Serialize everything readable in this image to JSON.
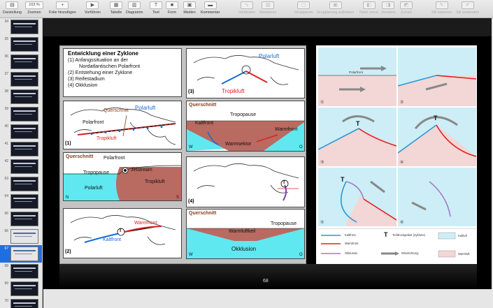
{
  "toolbar": {
    "items": [
      {
        "label": "Darstellung",
        "icon": "view-icon"
      },
      {
        "label": "Zoomen",
        "icon": "zoom-icon",
        "value": "103 %"
      },
      {
        "label": "Folie hinzufügen",
        "icon": "add-slide-icon"
      },
      {
        "label": "Vorführen",
        "icon": "play-icon"
      },
      {
        "label": "Tabelle",
        "icon": "table-icon"
      },
      {
        "label": "Diagramm",
        "icon": "chart-icon"
      },
      {
        "label": "Text",
        "icon": "text-icon"
      },
      {
        "label": "Form",
        "icon": "shape-icon"
      },
      {
        "label": "Medien",
        "icon": "media-icon"
      },
      {
        "label": "Kommentar",
        "icon": "comment-icon"
      },
      {
        "label": "Verbinden",
        "icon": "connect-icon"
      },
      {
        "label": "Maskieren",
        "icon": "mask-icon"
      },
      {
        "label": "Gruppieren",
        "icon": "group-icon"
      },
      {
        "label": "Gruppierung aufheben",
        "icon": "ungroup-icon"
      },
      {
        "label": "Nach vorne",
        "icon": "bring-forward-icon"
      },
      {
        "label": "Vorwärts",
        "icon": "forward-icon"
      },
      {
        "label": "Zurück",
        "icon": "backward-icon"
      },
      {
        "label": "Stil kopieren",
        "icon": "copy-style-icon"
      },
      {
        "label": "Stil anwenden",
        "icon": "paste-style-icon"
      }
    ]
  },
  "slides": [
    "34",
    "35",
    "36",
    "37",
    "38",
    "39",
    "40",
    "41",
    "42",
    "63",
    "64",
    "65",
    "66",
    "67",
    "68",
    "69",
    "70"
  ],
  "slide": {
    "title": "Entwicklung einer Zyklone",
    "list": [
      "(1)  Anfangssituation an der",
      "Nordatlantischen Polarfront",
      "(2)  Entstehung einer Zyklone",
      "(3)  Reifestadium",
      "(4)  Okklusion"
    ],
    "labels": {
      "querschnitt": "Querschnitt",
      "polarluft": "Polarluft",
      "polarfront": "Polarfront",
      "tropikluft": "Tropikluft",
      "tropopause": "Tropopause",
      "jetstream": "Jetstream",
      "warmfront": "Warmfront",
      "kaltfront": "Kaltfront",
      "warmsektor": "Warmsektor",
      "warmluftkeil": "Warmluftkeil",
      "okklusion": "Okklusion",
      "n": "N",
      "s": "S",
      "w": "W",
      "o": "O",
      "t": "T",
      "n1": "(1)",
      "n2": "(2)",
      "n3": "(3)",
      "n4": "(4)"
    },
    "page": "68"
  },
  "right_panel": {
    "polarfront": "Polarfront",
    "t": "T",
    "cells": [
      "①",
      "②",
      "③",
      "④",
      "⑤",
      "⑥"
    ],
    "legend": {
      "kaltfront": "Kaltfront",
      "warmfront": "Warmfront",
      "okklusion": "Okklusion",
      "tief": "Tiefdruckgebiet (Zyklone)",
      "wind": "Windrichtung",
      "kaltluft": "Kaltluft",
      "warmluft": "Warmluft",
      "t": "T"
    }
  }
}
